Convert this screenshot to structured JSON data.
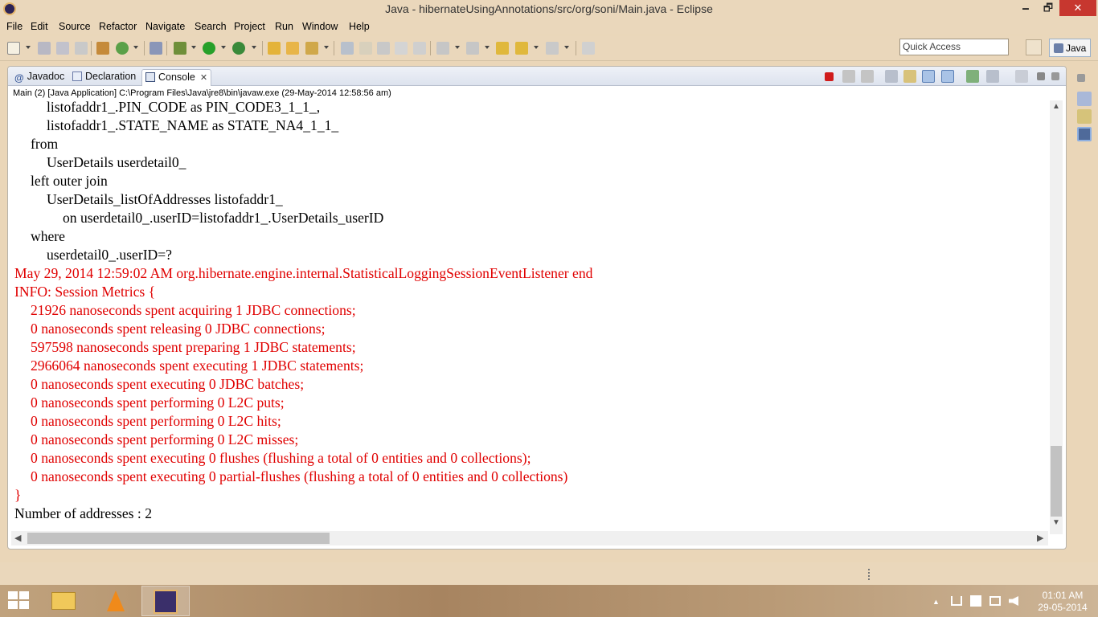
{
  "window": {
    "title": "Java - hibernateUsingAnnotations/src/org/soni/Main.java - Eclipse",
    "min": "🗕",
    "max": "🗗",
    "close": "✕"
  },
  "menu": [
    "File",
    "Edit",
    "Source",
    "Refactor",
    "Navigate",
    "Search",
    "Project",
    "Run",
    "Window",
    "Help"
  ],
  "toolbar": {
    "quick_access_placeholder": "Quick Access",
    "perspective": "Java"
  },
  "panel": {
    "tabs": [
      {
        "label": "Javadoc",
        "icon": "at-icon"
      },
      {
        "label": "Declaration",
        "icon": "declaration-icon"
      },
      {
        "label": "Console",
        "icon": "console-icon",
        "close": "✕"
      }
    ],
    "process_line": "Main (2) [Java Application] C:\\Program Files\\Java\\jre8\\bin\\javaw.exe (29-May-2014 12:58:56 am)"
  },
  "console": {
    "lines": [
      {
        "text": "listofaddr1_.PIN_CODE as PIN_CODE3_1_1_,",
        "indent": 2,
        "kind": "out"
      },
      {
        "text": "listofaddr1_.STATE_NAME as STATE_NA4_1_1_",
        "indent": 2,
        "kind": "out"
      },
      {
        "text": "from",
        "indent": 1,
        "kind": "out"
      },
      {
        "text": "UserDetails userdetail0_",
        "indent": 2,
        "kind": "out"
      },
      {
        "text": "left outer join",
        "indent": 1,
        "kind": "out"
      },
      {
        "text": "UserDetails_listOfAddresses listofaddr1_",
        "indent": 2,
        "kind": "out"
      },
      {
        "text": "on userdetail0_.userID=listofaddr1_.UserDetails_userID",
        "indent": 3,
        "kind": "out"
      },
      {
        "text": "where",
        "indent": 1,
        "kind": "out"
      },
      {
        "text": "userdetail0_.userID=?",
        "indent": 2,
        "kind": "out"
      },
      {
        "text": "May 29, 2014 12:59:02 AM org.hibernate.engine.internal.StatisticalLoggingSessionEventListener end",
        "indent": 0,
        "kind": "err"
      },
      {
        "text": "INFO: Session Metrics {",
        "indent": 0,
        "kind": "err"
      },
      {
        "text": "21926 nanoseconds spent acquiring 1 JDBC connections;",
        "indent": 1,
        "kind": "err"
      },
      {
        "text": "0 nanoseconds spent releasing 0 JDBC connections;",
        "indent": 1,
        "kind": "err"
      },
      {
        "text": "597598 nanoseconds spent preparing 1 JDBC statements;",
        "indent": 1,
        "kind": "err"
      },
      {
        "text": "2966064 nanoseconds spent executing 1 JDBC statements;",
        "indent": 1,
        "kind": "err"
      },
      {
        "text": "0 nanoseconds spent executing 0 JDBC batches;",
        "indent": 1,
        "kind": "err"
      },
      {
        "text": "0 nanoseconds spent performing 0 L2C puts;",
        "indent": 1,
        "kind": "err"
      },
      {
        "text": "0 nanoseconds spent performing 0 L2C hits;",
        "indent": 1,
        "kind": "err"
      },
      {
        "text": "0 nanoseconds spent performing 0 L2C misses;",
        "indent": 1,
        "kind": "err"
      },
      {
        "text": "0 nanoseconds spent executing 0 flushes (flushing a total of 0 entities and 0 collections);",
        "indent": 1,
        "kind": "err"
      },
      {
        "text": "0 nanoseconds spent executing 0 partial-flushes (flushing a total of 0 entities and 0 collections)",
        "indent": 1,
        "kind": "err"
      },
      {
        "text": "}",
        "indent": 0,
        "kind": "err"
      },
      {
        "text": "Number of addresses : 2",
        "indent": 0,
        "kind": "out"
      }
    ],
    "colors": {
      "out": "#000000",
      "err": "#e00000"
    }
  },
  "taskbar": {
    "apps": [
      "file-explorer",
      "vlc-player",
      "eclipse-java-ee"
    ],
    "tray_expand": "▲",
    "clock_time": "01:01 AM",
    "clock_date": "29-05-2014"
  }
}
